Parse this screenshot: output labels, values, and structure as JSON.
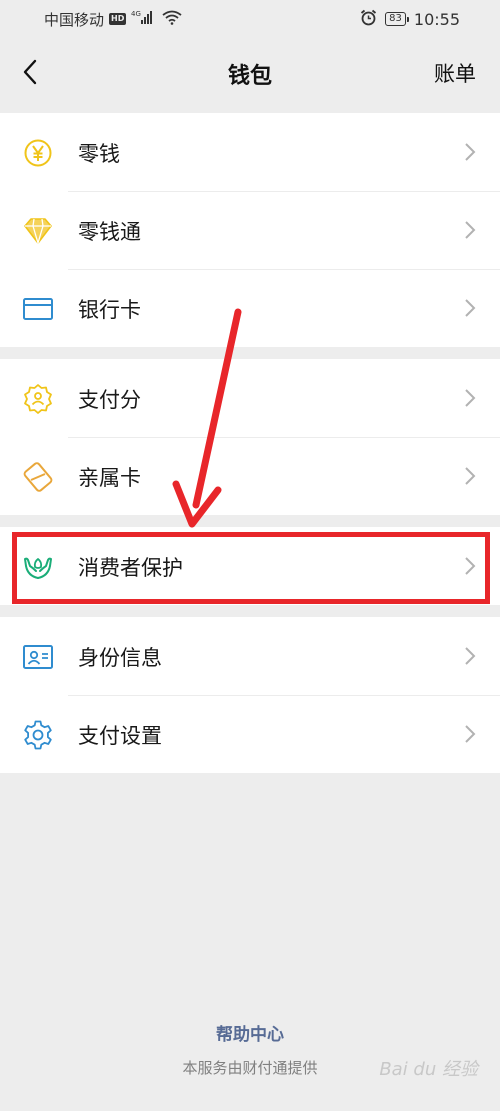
{
  "status_bar": {
    "carrier": "中国移动",
    "network_badge": "HD",
    "signal_label": "4G",
    "battery": "83",
    "time": "10:55"
  },
  "nav": {
    "title": "钱包",
    "right_action": "账单"
  },
  "groups": [
    {
      "items": [
        {
          "label": "零钱",
          "icon": "coin-yen-icon"
        },
        {
          "label": "零钱通",
          "icon": "diamond-icon"
        },
        {
          "label": "银行卡",
          "icon": "bank-card-icon"
        }
      ]
    },
    {
      "items": [
        {
          "label": "支付分",
          "icon": "score-badge-icon"
        },
        {
          "label": "亲属卡",
          "icon": "family-card-icon"
        }
      ]
    },
    {
      "items": [
        {
          "label": "消费者保护",
          "icon": "hands-protect-icon"
        }
      ]
    },
    {
      "items": [
        {
          "label": "身份信息",
          "icon": "id-card-icon"
        },
        {
          "label": "支付设置",
          "icon": "gear-icon"
        }
      ]
    }
  ],
  "footer": {
    "help_link": "帮助中心",
    "provider_note": "本服务由财付通提供"
  },
  "watermark": "Bai du 经验",
  "colors": {
    "background": "#ededed",
    "coin_yellow": "#f0c419",
    "card_blue": "#2f8ccf",
    "protect_green": "#1aad78",
    "annotation_red": "#e8262a",
    "link_blue": "#576b95"
  }
}
